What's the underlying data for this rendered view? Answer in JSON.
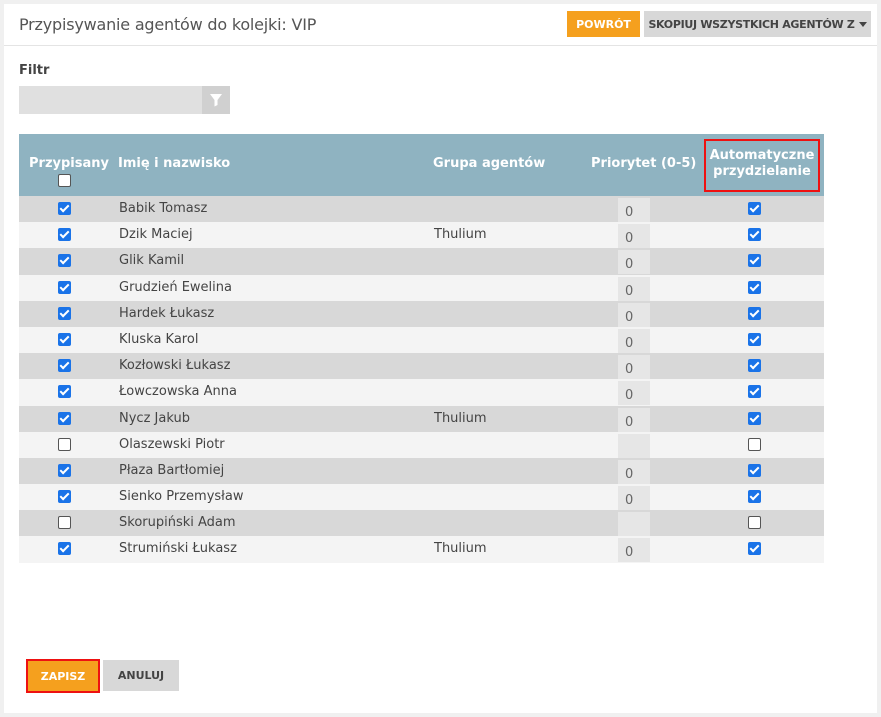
{
  "header": {
    "title": "Przypisywanie agentów do kolejki: VIP",
    "back_label": "POWRÓT",
    "copy_label": "SKOPIUJ WSZYSTKICH AGENTÓW Z"
  },
  "filter": {
    "label": "Filtr",
    "value": "",
    "placeholder": ""
  },
  "table": {
    "columns": {
      "assigned": "Przypisany",
      "name": "Imię i nazwisko",
      "group": "Grupa agentów",
      "priority": "Priorytet (0-5)",
      "auto_line1": "Automatyczne",
      "auto_line2": "przydzielanie"
    },
    "rows": [
      {
        "assigned": true,
        "name": "Babik Tomasz",
        "group": "",
        "priority": "0",
        "auto": true
      },
      {
        "assigned": true,
        "name": "Dzik Maciej",
        "group": "Thulium",
        "priority": "0",
        "auto": true
      },
      {
        "assigned": true,
        "name": "Glik Kamil",
        "group": "",
        "priority": "0",
        "auto": true
      },
      {
        "assigned": true,
        "name": "Grudzień Ewelina",
        "group": "",
        "priority": "0",
        "auto": true
      },
      {
        "assigned": true,
        "name": "Hardek Łukasz",
        "group": "",
        "priority": "0",
        "auto": true
      },
      {
        "assigned": true,
        "name": "Kluska Karol",
        "group": "",
        "priority": "0",
        "auto": true
      },
      {
        "assigned": true,
        "name": "Kozłowski Łukasz",
        "group": "",
        "priority": "0",
        "auto": true
      },
      {
        "assigned": true,
        "name": "Łowczowska Anna",
        "group": "",
        "priority": "0",
        "auto": true
      },
      {
        "assigned": true,
        "name": "Nycz Jakub",
        "group": "Thulium",
        "priority": "0",
        "auto": true
      },
      {
        "assigned": false,
        "name": "Olaszewski Piotr",
        "group": "",
        "priority": "",
        "auto": false
      },
      {
        "assigned": true,
        "name": "Płaza Bartłomiej",
        "group": "",
        "priority": "0",
        "auto": true
      },
      {
        "assigned": true,
        "name": "Sienko Przemysław",
        "group": "",
        "priority": "0",
        "auto": true
      },
      {
        "assigned": false,
        "name": "Skorupiński Adam",
        "group": "",
        "priority": "",
        "auto": false
      },
      {
        "assigned": true,
        "name": "Strumiński Łukasz",
        "group": "Thulium",
        "priority": "0",
        "auto": true
      }
    ]
  },
  "footer": {
    "save_label": "ZAPISZ",
    "cancel_label": "ANULUJ"
  },
  "icons": {
    "filter": "filter-icon",
    "dropdown": "caret-down-icon",
    "checkbox": "checkbox"
  },
  "colors": {
    "accent": "#f5a01e",
    "table_header": "#8fb3c1",
    "checkbox_checked": "#1a73e8",
    "highlight": "#e11111"
  }
}
